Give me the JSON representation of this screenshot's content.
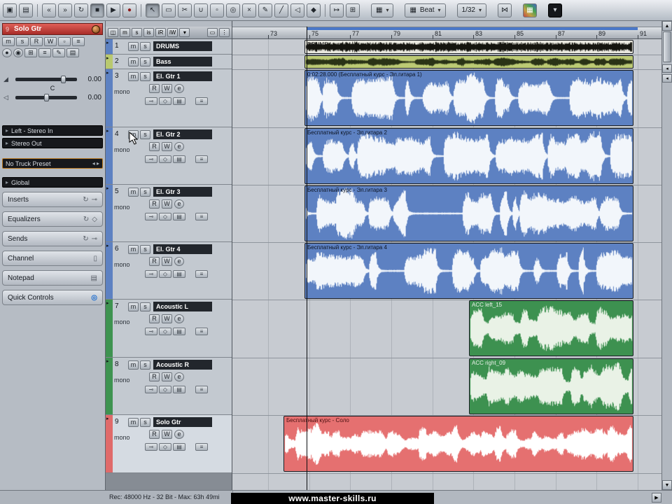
{
  "toolbar": {
    "left_buttons": [
      "▣",
      "▤"
    ],
    "transport": [
      "«",
      "»",
      "↻",
      "■",
      "▶",
      "●"
    ],
    "tools": [
      "↖",
      "▭",
      "✂",
      "∪",
      "▫",
      "◎",
      "×",
      "✎",
      "╱",
      "◁",
      "◆"
    ],
    "aux_buttons": [
      "↦",
      "⊞"
    ],
    "grid_icon": "▦",
    "beat_label": "Beat",
    "caret": "▾",
    "quantize_label": "1/32",
    "crossfade_icon": "⋈",
    "colors_icon": "▦"
  },
  "inspector": {
    "track_number": "9",
    "track_name": "Solo Gtr",
    "row1_buttons": [
      "m",
      "s",
      "R",
      "W",
      "▫",
      "≡"
    ],
    "row2_buttons": [
      "●",
      "◉",
      "⊞",
      "≡",
      "✎",
      "▤"
    ],
    "fader_icons": [
      "◢",
      "◁"
    ],
    "volume": "0.00",
    "pan": "C",
    "delay": "0.00",
    "input_routing": "Left - Stereo In",
    "output_routing": "Stereo Out",
    "preset_label": "No Truck Preset",
    "preset_arrows": "◂ ▸",
    "global_label": "Global",
    "sections": [
      {
        "label": "Inserts",
        "icon": "↻",
        "icon2": "⊸"
      },
      {
        "label": "Equalizers",
        "icon": "↻",
        "icon2": "◇"
      },
      {
        "label": "Sends",
        "icon": "↻",
        "icon2": "⊸"
      },
      {
        "label": "Channel",
        "icon": "",
        "icon2": "▯"
      },
      {
        "label": "Notepad",
        "icon": "",
        "icon2": "▤"
      },
      {
        "label": "Quick Controls",
        "icon": "",
        "icon2": "◎"
      }
    ]
  },
  "tracklist_header": {
    "icon": "◫",
    "buttons": [
      "m",
      "s",
      "is",
      "iR",
      "iW"
    ],
    "caret": "▾",
    "right_icons": [
      "▭",
      "⋮"
    ]
  },
  "track_buttons": {
    "expand": "▸",
    "mute": "m",
    "solo": "s",
    "read": "R",
    "write": "W",
    "edit": "e",
    "icons": [
      "⊸",
      "◇",
      "▤"
    ],
    "more": "≡"
  },
  "tracks": [
    {
      "num": "1",
      "name": "DRUMS",
      "mono": ""
    },
    {
      "num": "2",
      "name": "Bass",
      "mono": ""
    },
    {
      "num": "3",
      "name": "El. Gtr 1",
      "mono": "mono"
    },
    {
      "num": "4",
      "name": "El. Gtr 2",
      "mono": "mono"
    },
    {
      "num": "5",
      "name": "El. Gtr 3",
      "mono": "mono"
    },
    {
      "num": "6",
      "name": "El. Gtr 4",
      "mono": "mono"
    },
    {
      "num": "7",
      "name": "Acoustic L",
      "mono": "mono"
    },
    {
      "num": "8",
      "name": "Acoustic R",
      "mono": "mono"
    },
    {
      "num": "9",
      "name": "Solo Gtr",
      "mono": "mono"
    }
  ],
  "ruler": {
    "marks": [
      "73",
      "75",
      "77",
      "79",
      "81",
      "83",
      "85",
      "87",
      "89",
      "91"
    ]
  },
  "clips": [
    {
      "label": "DRUMS"
    },
    {
      "label": ""
    },
    {
      "label": "0:02:28.000 (Бесплатный курс - Эл.гитара 1)"
    },
    {
      "label": "Бесплатный курс - Эл.гитара 2"
    },
    {
      "label": "Бесплатный курс - Эл.гитара 3"
    },
    {
      "label": "Бесплатный курс - Эл.гитара 4"
    },
    {
      "label": "ACC left_15"
    },
    {
      "label": "ACC right_09"
    },
    {
      "label": "Бесплатный курс - Соло"
    }
  ],
  "colors": {
    "track_blue": "#5d81c2",
    "bass_green": "#b9c96f",
    "acoustic_green": "#3e9350",
    "solo_red": "#e06a6a",
    "cycle_blue": "#4a78c8"
  },
  "scrollbar": {
    "up": "▲",
    "down": "▼",
    "left": "◀",
    "right": "▶",
    "mini": "◂"
  },
  "statusbar": {
    "record_info": "Rec: 48000 Hz - 32 Bit - Max: 63h 49mi",
    "watermark": "www.master-skills.ru"
  }
}
